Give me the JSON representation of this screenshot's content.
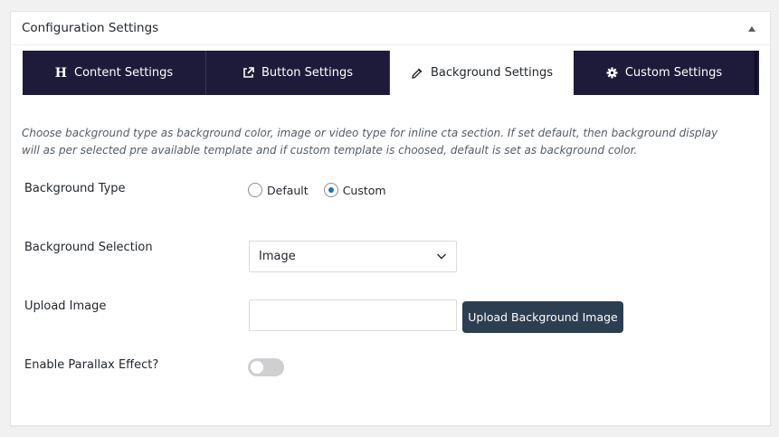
{
  "panel": {
    "title": "Configuration Settings"
  },
  "tabs": [
    {
      "label": "Content Settings",
      "icon": "heading-icon",
      "active": false
    },
    {
      "label": "Button Settings",
      "icon": "external-link-icon",
      "active": false
    },
    {
      "label": "Background Settings",
      "icon": "eyedropper-icon",
      "active": true
    },
    {
      "label": "Custom Settings",
      "icon": "gear-icon",
      "active": false
    }
  ],
  "description": "Choose background type as background color, image or video type for inline cta section. If set default, then background display will as per selected pre available template and if custom template is choosed, default is set as background color.",
  "fields": {
    "background_type": {
      "label": "Background Type",
      "options": [
        "Default",
        "Custom"
      ],
      "selected": "Custom"
    },
    "background_selection": {
      "label": "Background Selection",
      "value": "Image"
    },
    "upload_image": {
      "label": "Upload Image",
      "value": "",
      "button_label": "Upload Background Image"
    },
    "parallax": {
      "label": "Enable Parallax Effect?",
      "enabled": false
    }
  },
  "colors": {
    "tab_bar": "#1e1b3a",
    "button": "#2c3e50",
    "radio_accent": "#2271b1"
  }
}
